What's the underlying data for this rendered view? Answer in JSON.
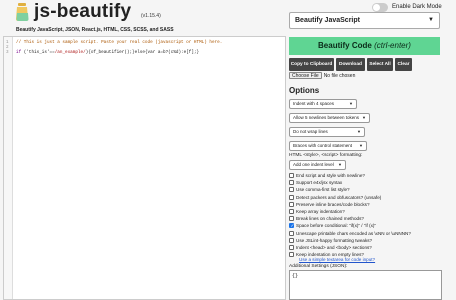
{
  "header": {
    "title": "js-beautify",
    "version": "(v1.15.4)",
    "subtitle": "Beautify JavaScript, JSON, React.js, HTML, CSS, SCSS, and SASS",
    "dark_mode_label": "Enable Dark Mode",
    "dark_mode_on": false
  },
  "editor": {
    "line1_num": "1",
    "line1_text": "// This is just a sample script. Paste your real code (javascript or HTML) here.",
    "line2_num": "2",
    "line3_num": "3",
    "line3_kw": "if",
    "line3_a": " ('this_is'==",
    "line3_str": "/an_example/",
    "line3_b": "){of_beautifier();}else{var a=b?(c%d):e[f];}"
  },
  "language": {
    "selected": "Beautify JavaScript"
  },
  "actions": {
    "beautify_label": "Beautify Code",
    "beautify_shortcut": "(ctrl-enter)",
    "copy_label": "Copy to Clipboard",
    "download_label": "Download",
    "select_all_label": "Select All",
    "clear_label": "Clear",
    "choose_file_label": "Choose File",
    "no_file_label": "No file chosen"
  },
  "options": {
    "title": "Options",
    "indent": "Indent with 4 spaces",
    "newlines": "Allow 5 newlines between tokens",
    "wrap": "Do not wrap lines",
    "braces": "Braces with control statement",
    "html_formatting_label": "HTML <style>, <script> formatting:",
    "html_formatting": "Add one indent level",
    "checkboxes": [
      {
        "label": "End script and style with newline?",
        "checked": false
      },
      {
        "label": "Support e4x/jsx syntax",
        "checked": false
      },
      {
        "label": "Use comma-first list style?",
        "checked": false
      },
      {
        "label": "Detect packers and obfuscators? (unsafe)",
        "checked": false
      },
      {
        "label": "Preserve inline braces/code blocks?",
        "checked": false
      },
      {
        "label": "Keep array indentation?",
        "checked": false
      },
      {
        "label": "Break lines on chained methods?",
        "checked": false
      },
      {
        "label": "Space before conditional: \"if(x)\" / \"if (x)\"",
        "checked": true
      },
      {
        "label": "Unescape printable chars encoded as \\xNN or \\uNNNN?",
        "checked": false
      },
      {
        "label": "Use JSLint-happy formatting tweaks?",
        "checked": false
      },
      {
        "label": "Indent <head> and <body> sections?",
        "checked": false
      },
      {
        "label": "Keep indentation on empty lines?",
        "checked": false
      }
    ],
    "link_label": "Use a simple textarea for code input?",
    "additional_label": "Additional Settings (JSON):",
    "additional_value": "{}"
  },
  "colors": {
    "accent_green": "#5fd593",
    "button_dark": "#444444",
    "checkbox_on": "#1a73e8"
  }
}
